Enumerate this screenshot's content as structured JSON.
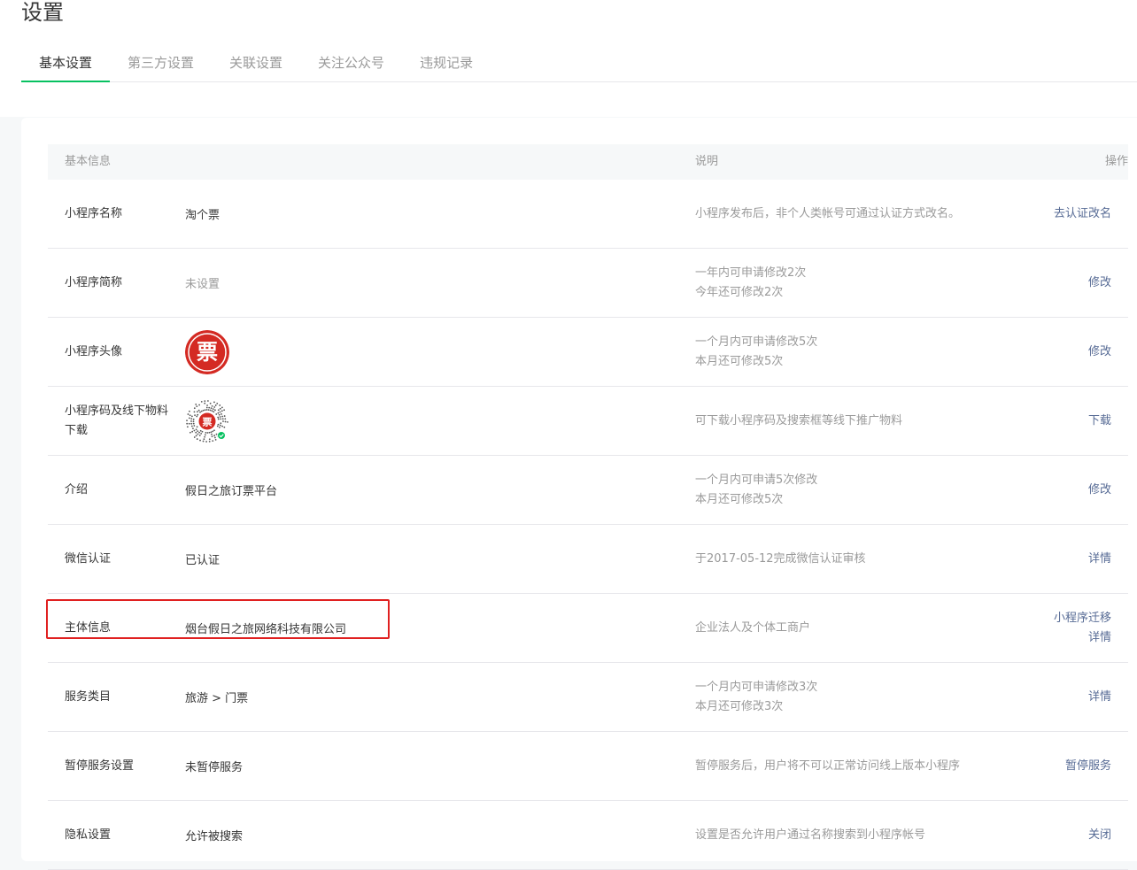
{
  "page": {
    "title": "设置"
  },
  "tabs": [
    {
      "label": "基本设置",
      "active": true
    },
    {
      "label": "第三方设置",
      "active": false
    },
    {
      "label": "关联设置",
      "active": false
    },
    {
      "label": "关注公众号",
      "active": false
    },
    {
      "label": "违规记录",
      "active": false
    }
  ],
  "table": {
    "headers": {
      "label": "基本信息",
      "desc": "说明",
      "action": "操作"
    },
    "rows": [
      {
        "label": "小程序名称",
        "value": "淘个票",
        "desc": [
          "小程序发布后，非个人类帐号可通过认证方式改名。"
        ],
        "actions": [
          "去认证改名"
        ]
      },
      {
        "label": "小程序简称",
        "value": "未设置",
        "desc": [
          "一年内可申请修改2次",
          "今年还可修改2次"
        ],
        "actions": [
          "修改"
        ]
      },
      {
        "label": "小程序头像",
        "value": "",
        "desc": [
          "一个月内可申请修改5次",
          "本月还可修改5次"
        ],
        "actions": [
          "修改"
        ]
      },
      {
        "label": "小程序码及线下物料下载",
        "value": "",
        "desc": [
          "可下载小程序码及搜索框等线下推广物料"
        ],
        "actions": [
          "下载"
        ]
      },
      {
        "label": "介绍",
        "value": "假日之旅订票平台",
        "desc": [
          "一个月内可申请5次修改",
          "本月还可修改5次"
        ],
        "actions": [
          "修改"
        ]
      },
      {
        "label": "微信认证",
        "value": "已认证",
        "desc": [
          "于2017-05-12完成微信认证审核"
        ],
        "actions": [
          "详情"
        ]
      },
      {
        "label": "主体信息",
        "value": "烟台假日之旅网络科技有限公司",
        "desc": [
          "企业法人及个体工商户"
        ],
        "actions": [
          "小程序迁移",
          "详情"
        ]
      },
      {
        "label": "服务类目",
        "value": "旅游 > 门票",
        "desc": [
          "一个月内可申请修改3次",
          "本月还可修改3次"
        ],
        "actions": [
          "详情"
        ]
      },
      {
        "label": "暂停服务设置",
        "value": "未暂停服务",
        "desc": [
          "暂停服务后，用户将不可以正常访问线上版本小程序"
        ],
        "actions": [
          "暂停服务"
        ]
      },
      {
        "label": "隐私设置",
        "value": "允许被搜索",
        "desc": [
          "设置是否允许用户通过名称搜索到小程序帐号"
        ],
        "actions": [
          "关闭"
        ]
      }
    ]
  },
  "avatar": {
    "glyph": "票",
    "color": "#d42a23"
  },
  "colors": {
    "accent": "#07c160",
    "link": "#576b95",
    "highlight": "#e02020"
  }
}
